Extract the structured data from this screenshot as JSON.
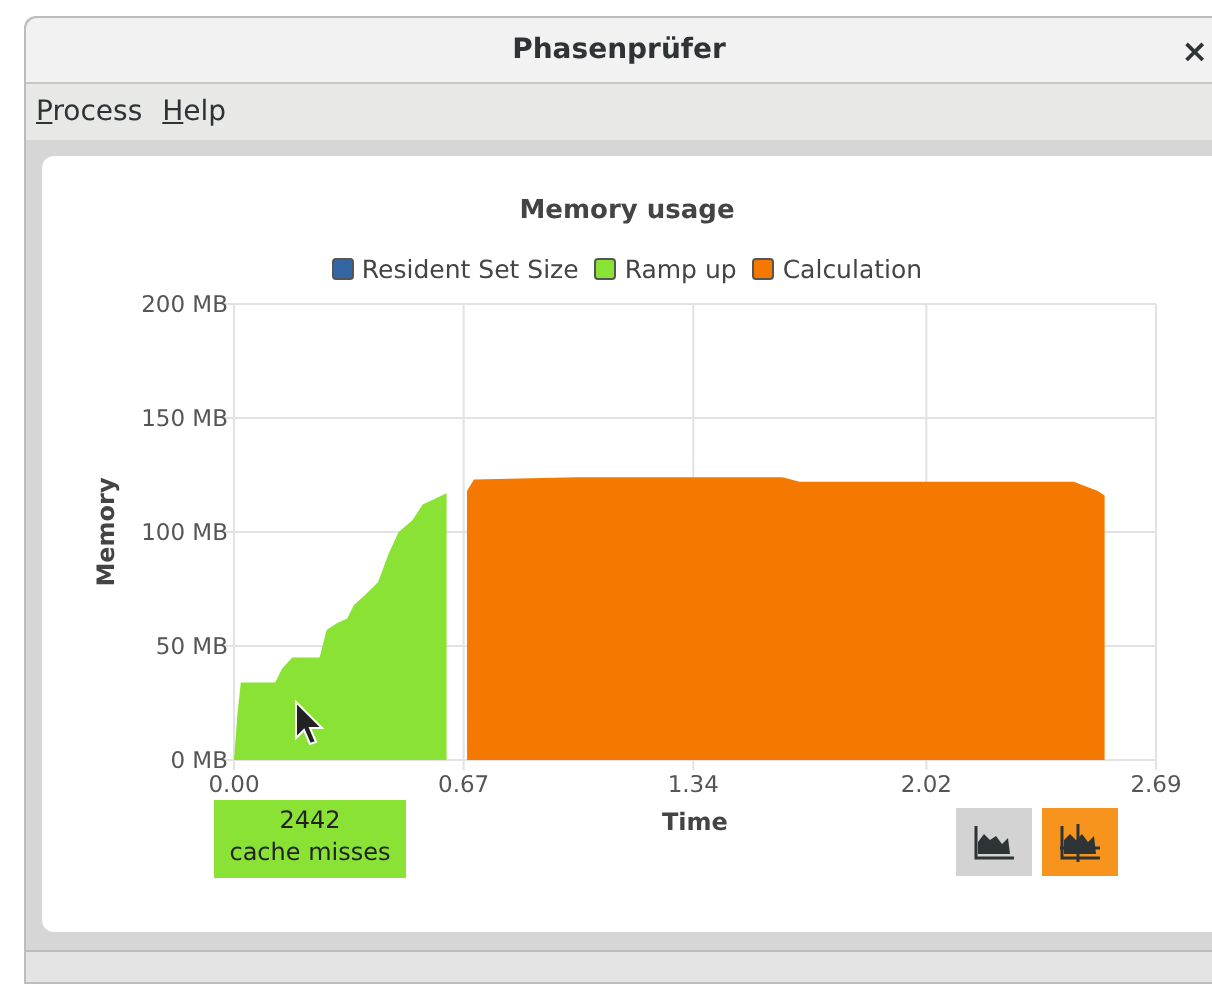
{
  "window": {
    "title": "Phasenprüfer",
    "close": "×"
  },
  "menu": [
    {
      "label": "Process"
    },
    {
      "label": "Help"
    }
  ],
  "chart": {
    "chart_data": {
      "type": "area",
      "title": "Memory usage",
      "xlabel": "Time",
      "ylabel": "Memory",
      "x": [
        0,
        0.01,
        0.02,
        0.12,
        0.14,
        0.17,
        0.25,
        0.27,
        0.3,
        0.33,
        0.35,
        0.38,
        0.42,
        0.45,
        0.48,
        0.52,
        0.55,
        0.62,
        0.68,
        0.7,
        1.0,
        1.6,
        1.65,
        2.0,
        2.45,
        2.52,
        2.54
      ],
      "series": [
        {
          "name": "Resident Set Size",
          "color": "#3465a4",
          "values": [
            null,
            null,
            null,
            null,
            null,
            null,
            null,
            null,
            null,
            null,
            null,
            null,
            null,
            null,
            null,
            null,
            null,
            null,
            null,
            null,
            null,
            null,
            null,
            null,
            null,
            null,
            null
          ]
        },
        {
          "name": "Ramp up",
          "color": "#8ae234",
          "values": [
            0,
            20,
            34,
            34,
            40,
            45,
            45,
            57,
            60,
            62,
            68,
            72,
            78,
            90,
            100,
            105,
            112,
            117,
            null,
            null,
            null,
            null,
            null,
            null,
            null,
            null,
            null
          ]
        },
        {
          "name": "Calculation",
          "color": "#f57900",
          "values": [
            null,
            null,
            null,
            null,
            null,
            null,
            null,
            null,
            null,
            null,
            null,
            null,
            null,
            null,
            null,
            null,
            null,
            null,
            118,
            123,
            124,
            124,
            122,
            122,
            122,
            118,
            116
          ]
        }
      ],
      "grid": true,
      "xlim": [
        0,
        2.69
      ],
      "ylim": [
        0,
        200
      ],
      "xticks": [
        {
          "value": 0,
          "label": "0.00"
        },
        {
          "value": 0.67,
          "label": "0.67"
        },
        {
          "value": 1.34,
          "label": "1.34"
        },
        {
          "value": 2.02,
          "label": "2.02"
        },
        {
          "value": 2.69,
          "label": "2.69"
        }
      ],
      "yticks": [
        {
          "value": 0,
          "label": "0 MB"
        },
        {
          "value": 50,
          "label": "50 MB"
        },
        {
          "value": 100,
          "label": "100 MB"
        },
        {
          "value": 150,
          "label": "150 MB"
        },
        {
          "value": 200,
          "label": "200 MB"
        }
      ]
    },
    "counter": {
      "value": "2442",
      "label": "cache misses"
    },
    "view_toggles": [
      {
        "kind": "area",
        "selected": false
      },
      {
        "kind": "crosshair",
        "selected": true
      }
    ]
  }
}
